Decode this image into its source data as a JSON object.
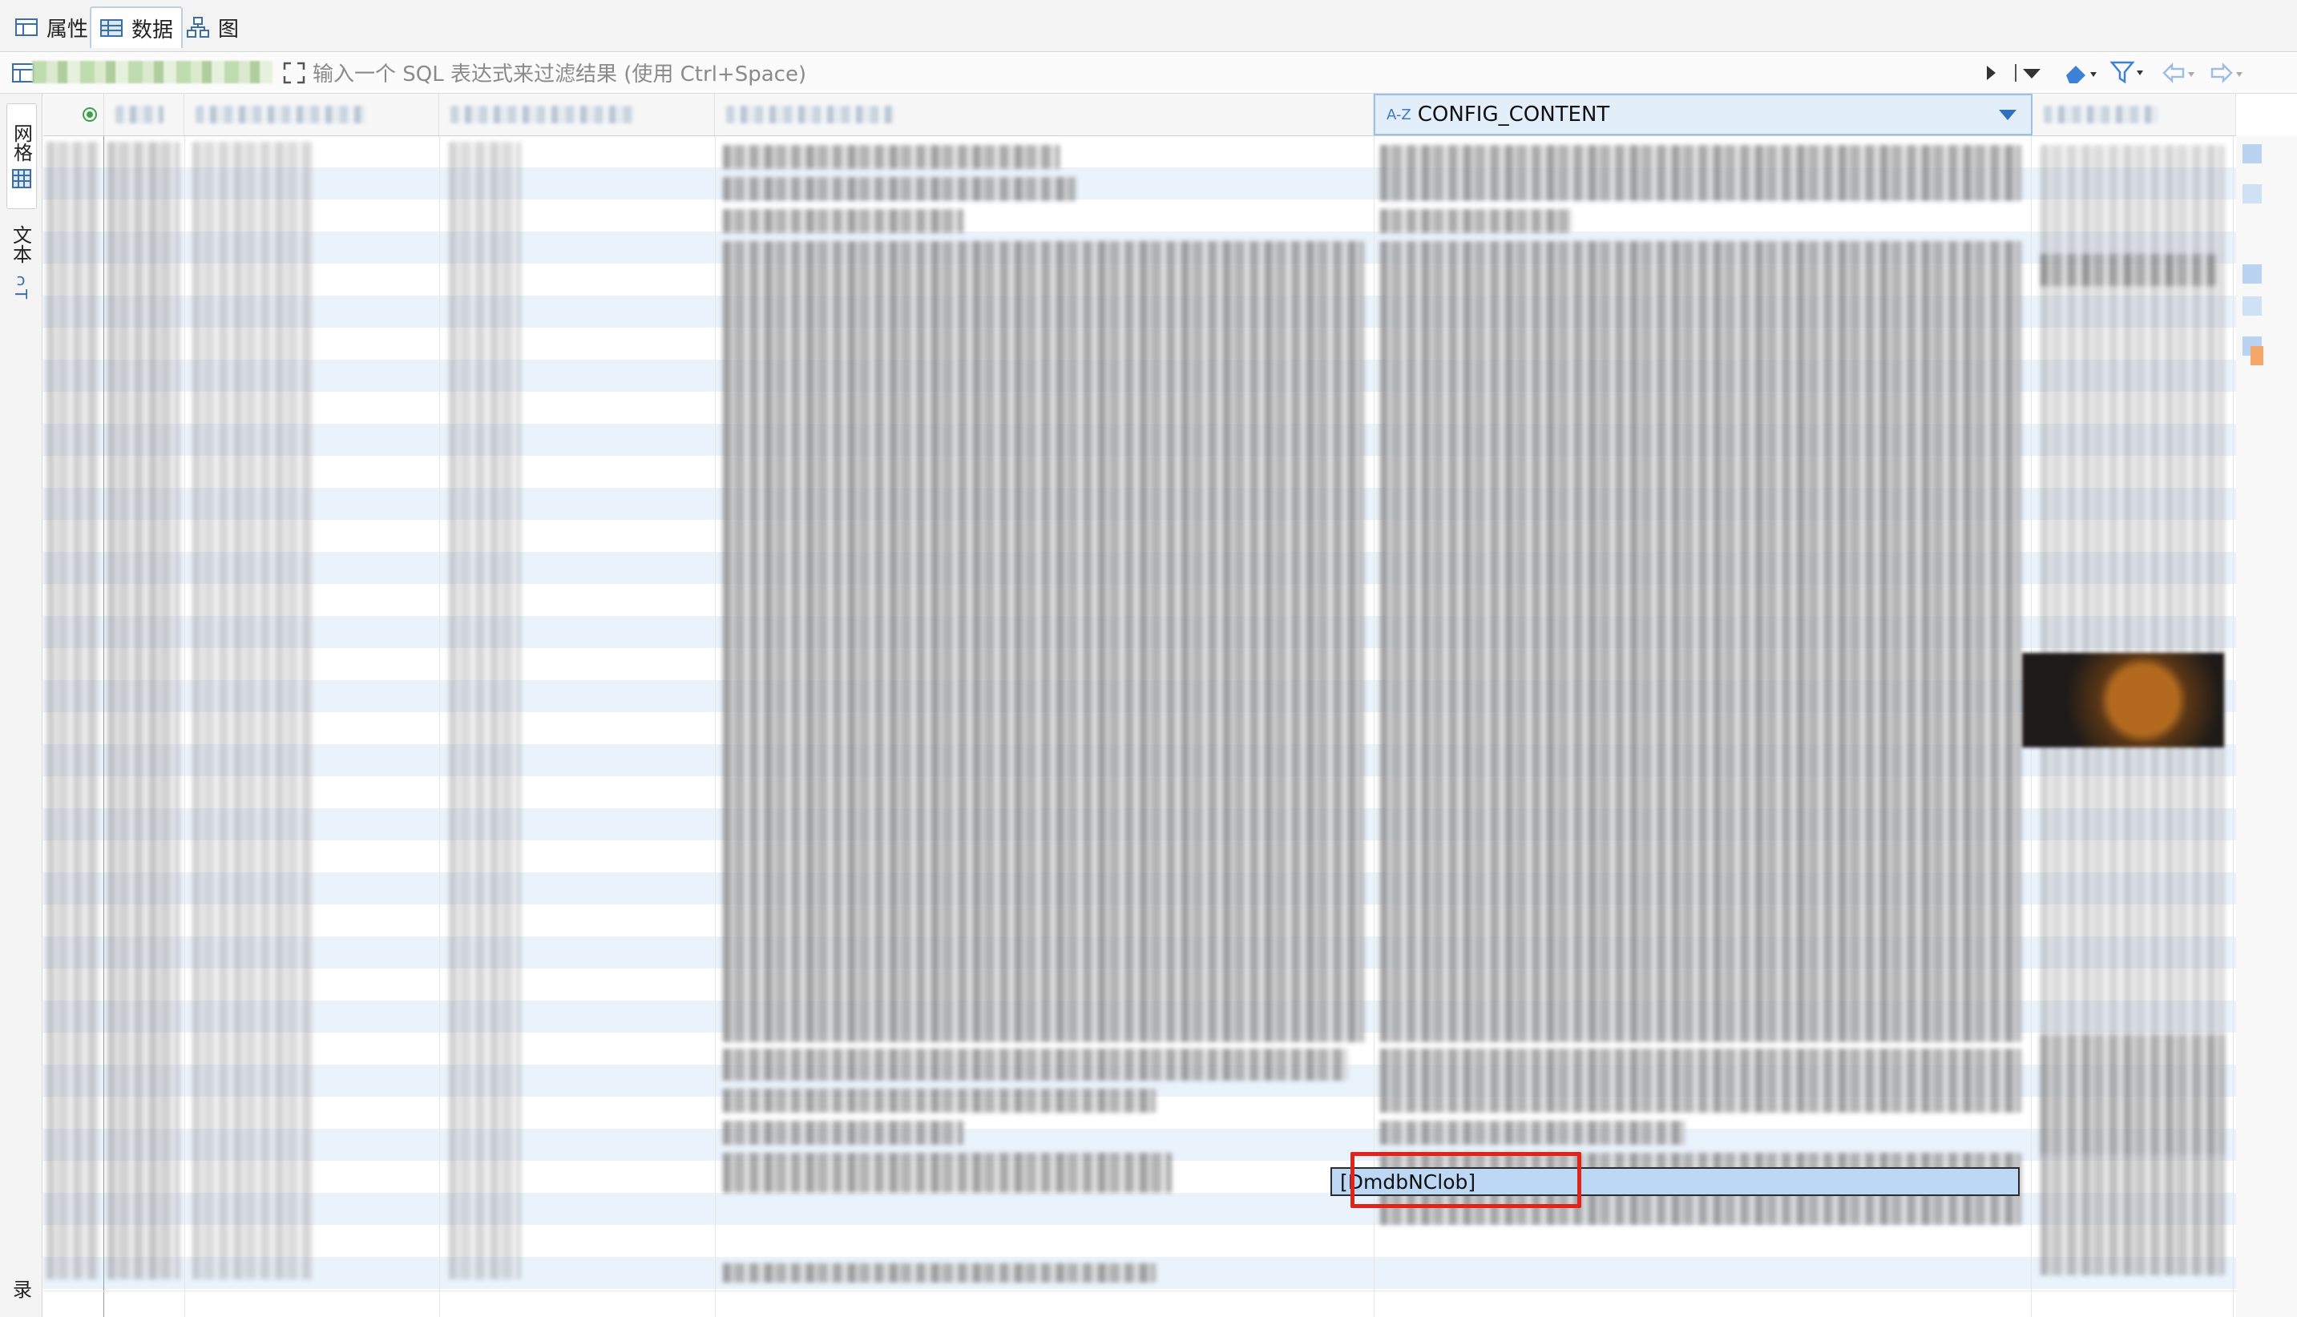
{
  "tabs": [
    {
      "label": "属性",
      "icon": "properties-icon",
      "active": false
    },
    {
      "label": "数据",
      "icon": "data-grid-icon",
      "active": true
    },
    {
      "label": "图",
      "icon": "diagram-icon",
      "active": false
    }
  ],
  "filter": {
    "placeholder": "输入一个 SQL 表达式来过滤结果 (使用 Ctrl+Space)"
  },
  "side_tabs": [
    {
      "label": "网格",
      "icon": "grid-view-icon"
    },
    {
      "label": "文本",
      "icon": "text-view-icon"
    }
  ],
  "side_bottom_label": "录",
  "grid": {
    "active_column": {
      "type_badge": "A-Z",
      "name": "CONFIG_CONTENT"
    },
    "selected_cell_value": "[DmdbNClob]"
  },
  "colors": {
    "accent": "#2f6fc2",
    "row_alt": "#eaf2fc",
    "selection": "#bcd8f5",
    "highlight_box": "#e2231a"
  }
}
